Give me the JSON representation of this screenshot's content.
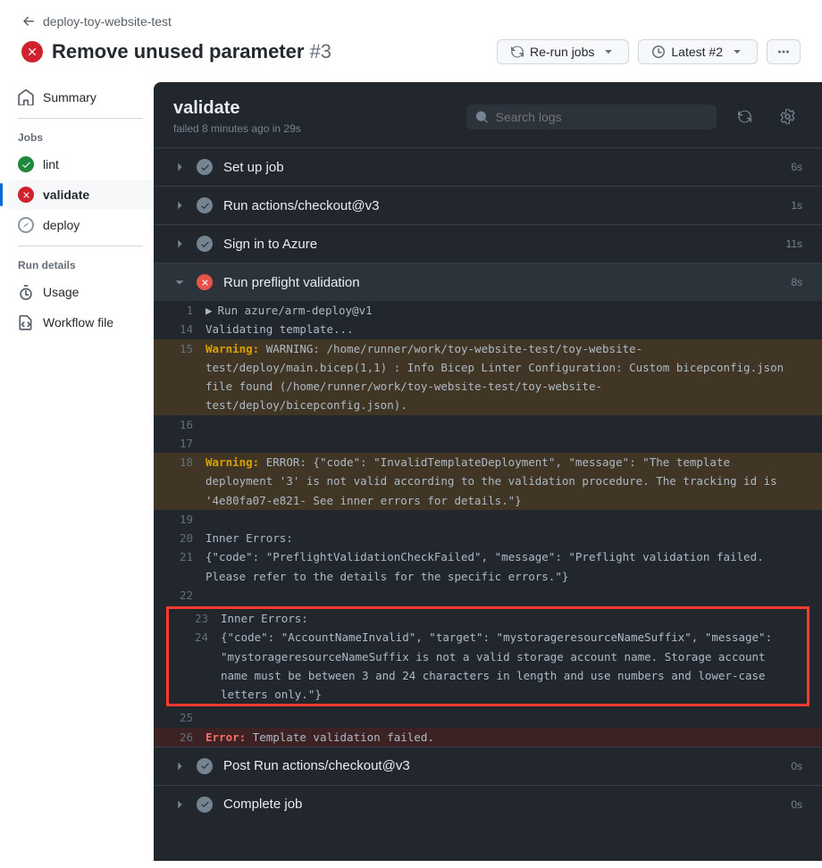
{
  "back_link": "deploy-toy-website-test",
  "header": {
    "title": "Remove unused parameter",
    "run_number": "#3",
    "rerun_label": "Re-run jobs",
    "latest_label": "Latest #2"
  },
  "sidebar": {
    "summary": "Summary",
    "jobs_heading": "Jobs",
    "jobs": [
      {
        "label": "lint",
        "status": "success"
      },
      {
        "label": "validate",
        "status": "fail",
        "active": true
      },
      {
        "label": "deploy",
        "status": "skip"
      }
    ],
    "details_heading": "Run details",
    "usage": "Usage",
    "workflow_file": "Workflow file"
  },
  "content": {
    "title": "validate",
    "subtitle": "failed 8 minutes ago in 29s",
    "search_placeholder": "Search logs"
  },
  "steps": [
    {
      "label": "Set up job",
      "duration": "6s",
      "status": "ok"
    },
    {
      "label": "Run actions/checkout@v3",
      "duration": "1s",
      "status": "ok"
    },
    {
      "label": "Sign in to Azure",
      "duration": "11s",
      "status": "ok"
    },
    {
      "label": "Run preflight validation",
      "duration": "8s",
      "status": "fail",
      "expanded": true
    },
    {
      "label": "Post Run actions/checkout@v3",
      "duration": "0s",
      "status": "ok"
    },
    {
      "label": "Complete job",
      "duration": "0s",
      "status": "ok"
    }
  ],
  "log": {
    "l1": "Run azure/arm-deploy@v1",
    "l14": "Validating template...",
    "l15_kw": "Warning:",
    "l15": " WARNING: /home/runner/work/toy-website-test/toy-website-test/deploy/main.bicep(1,1) : Info Bicep Linter Configuration: Custom bicepconfig.json file found (/home/runner/work/toy-website-test/toy-website-test/deploy/bicepconfig.json).",
    "l18_kw": "Warning:",
    "l18": " ERROR: {\"code\": \"InvalidTemplateDeployment\", \"message\": \"The template deployment '3' is not valid according to the validation procedure. The tracking id is '4e80fa07-e821- See inner errors for details.\"}",
    "l20": "Inner Errors:",
    "l21": "{\"code\": \"PreflightValidationCheckFailed\", \"message\": \"Preflight validation failed. Please refer to the details for the specific errors.\"}",
    "l23": "Inner Errors:",
    "l24": "{\"code\": \"AccountNameInvalid\", \"target\": \"mystorageresourceNameSuffix\", \"message\": \"mystorageresourceNameSuffix is not a valid storage account name. Storage account name must be between 3 and 24 characters in length and use numbers and lower-case letters only.\"}",
    "l26_kw": "Error:",
    "l26": " Template validation failed."
  }
}
